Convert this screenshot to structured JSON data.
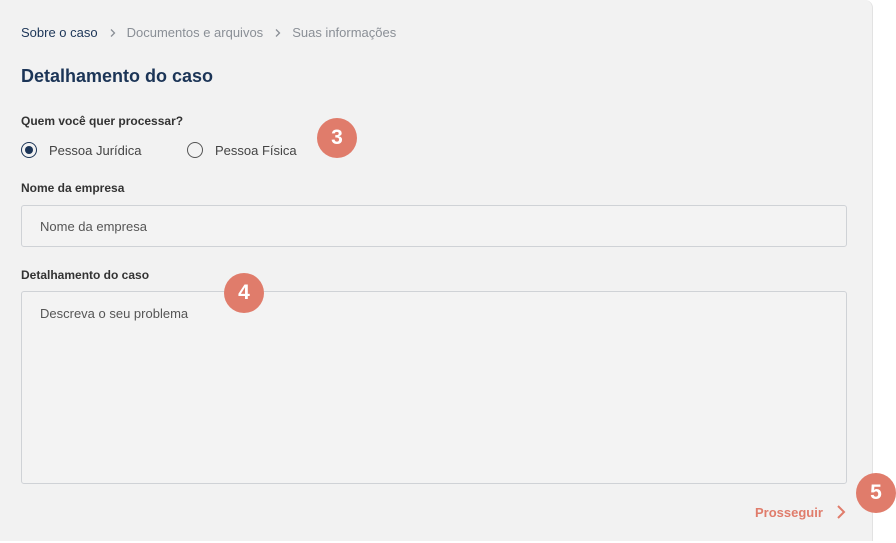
{
  "breadcrumb": {
    "items": [
      "Sobre o caso",
      "Documentos e arquivos",
      "Suas informações"
    ],
    "separator_icon": "chevron-right-icon"
  },
  "page_title": "Detalhamento do caso",
  "question": {
    "label": "Quem você quer processar?",
    "options": [
      {
        "label": "Pessoa Jurídica",
        "selected": true
      },
      {
        "label": "Pessoa Física",
        "selected": false
      }
    ]
  },
  "company_field": {
    "label": "Nome da empresa",
    "placeholder": "Nome da empresa",
    "value": ""
  },
  "details_field": {
    "label": "Detalhamento do caso",
    "placeholder": "Descreva o seu problema",
    "value": ""
  },
  "next_button": {
    "label": "Prosseguir",
    "icon": "chevron-right-icon"
  },
  "step_badges": [
    "3",
    "4",
    "5"
  ],
  "colors": {
    "primary": "#1c3557",
    "accent": "#e07c6b",
    "background": "#f2f2f2"
  }
}
